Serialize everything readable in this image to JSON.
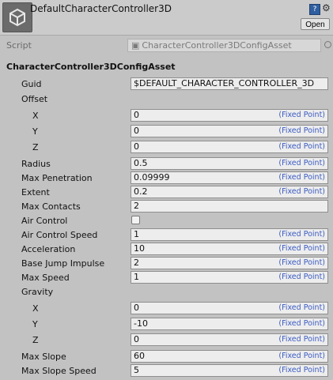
{
  "header": {
    "title": "DefaultCharacterController3D",
    "open_label": "Open",
    "help_label": "?",
    "icon": "unity-logo-icon"
  },
  "script": {
    "label": "Script",
    "value": "CharacterController3DConfigAsset"
  },
  "section": {
    "title": "CharacterController3DConfigAsset"
  },
  "fixed_point_label": "(Fixed Point)",
  "fields": {
    "guid": {
      "label": "Guid",
      "value": "$DEFAULT_CHARACTER_CONTROLLER_3D"
    },
    "offset": {
      "label": "Offset",
      "x": {
        "label": "X",
        "value": "0"
      },
      "y": {
        "label": "Y",
        "value": "0"
      },
      "z": {
        "label": "Z",
        "value": "0"
      }
    },
    "radius": {
      "label": "Radius",
      "value": "0.5"
    },
    "max_penetration": {
      "label": "Max Penetration",
      "value": "0.09999"
    },
    "extent": {
      "label": "Extent",
      "value": "0.2"
    },
    "max_contacts": {
      "label": "Max Contacts",
      "value": "2"
    },
    "air_control": {
      "label": "Air Control",
      "checked": false
    },
    "air_control_speed": {
      "label": "Air Control Speed",
      "value": "1"
    },
    "acceleration": {
      "label": "Acceleration",
      "value": "10"
    },
    "base_jump_impulse": {
      "label": "Base Jump Impulse",
      "value": "2"
    },
    "max_speed": {
      "label": "Max Speed",
      "value": "1"
    },
    "gravity": {
      "label": "Gravity",
      "x": {
        "label": "X",
        "value": "0"
      },
      "y": {
        "label": "Y",
        "value": "-10"
      },
      "z": {
        "label": "Z",
        "value": "0"
      }
    },
    "max_slope": {
      "label": "Max Slope",
      "value": "60"
    },
    "max_slope_speed": {
      "label": "Max Slope Speed",
      "value": "5"
    }
  }
}
